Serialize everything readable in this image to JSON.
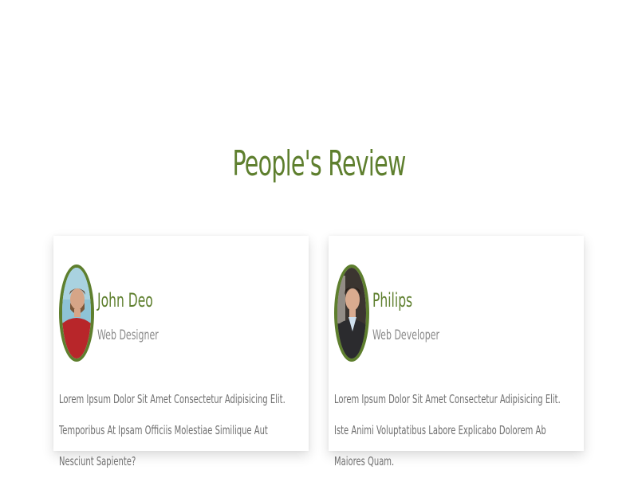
{
  "colors": {
    "accent": "#5e7f2e",
    "name": "#5e7f2e",
    "role": "#8a8a8a",
    "text": "#6f6f6f"
  },
  "section": {
    "title": "People's Review"
  },
  "reviews": [
    {
      "name": "John Deo",
      "role": "Web Designer",
      "text": "Lorem Ipsum Dolor Sit Amet Consectetur Adipisicing Elit. Temporibus At Ipsam Officiis Molestiae Similique Aut Nesciunt Sapiente?",
      "avatar_icon": "person-photo-icon"
    },
    {
      "name": "Philips",
      "role": "Web Developer",
      "text": "Lorem Ipsum Dolor Sit Amet Consectetur Adipisicing Elit. Iste Animi Voluptatibus Labore Explicabo Dolorem Ab Maiores Quam.",
      "avatar_icon": "person-photo-icon"
    }
  ]
}
